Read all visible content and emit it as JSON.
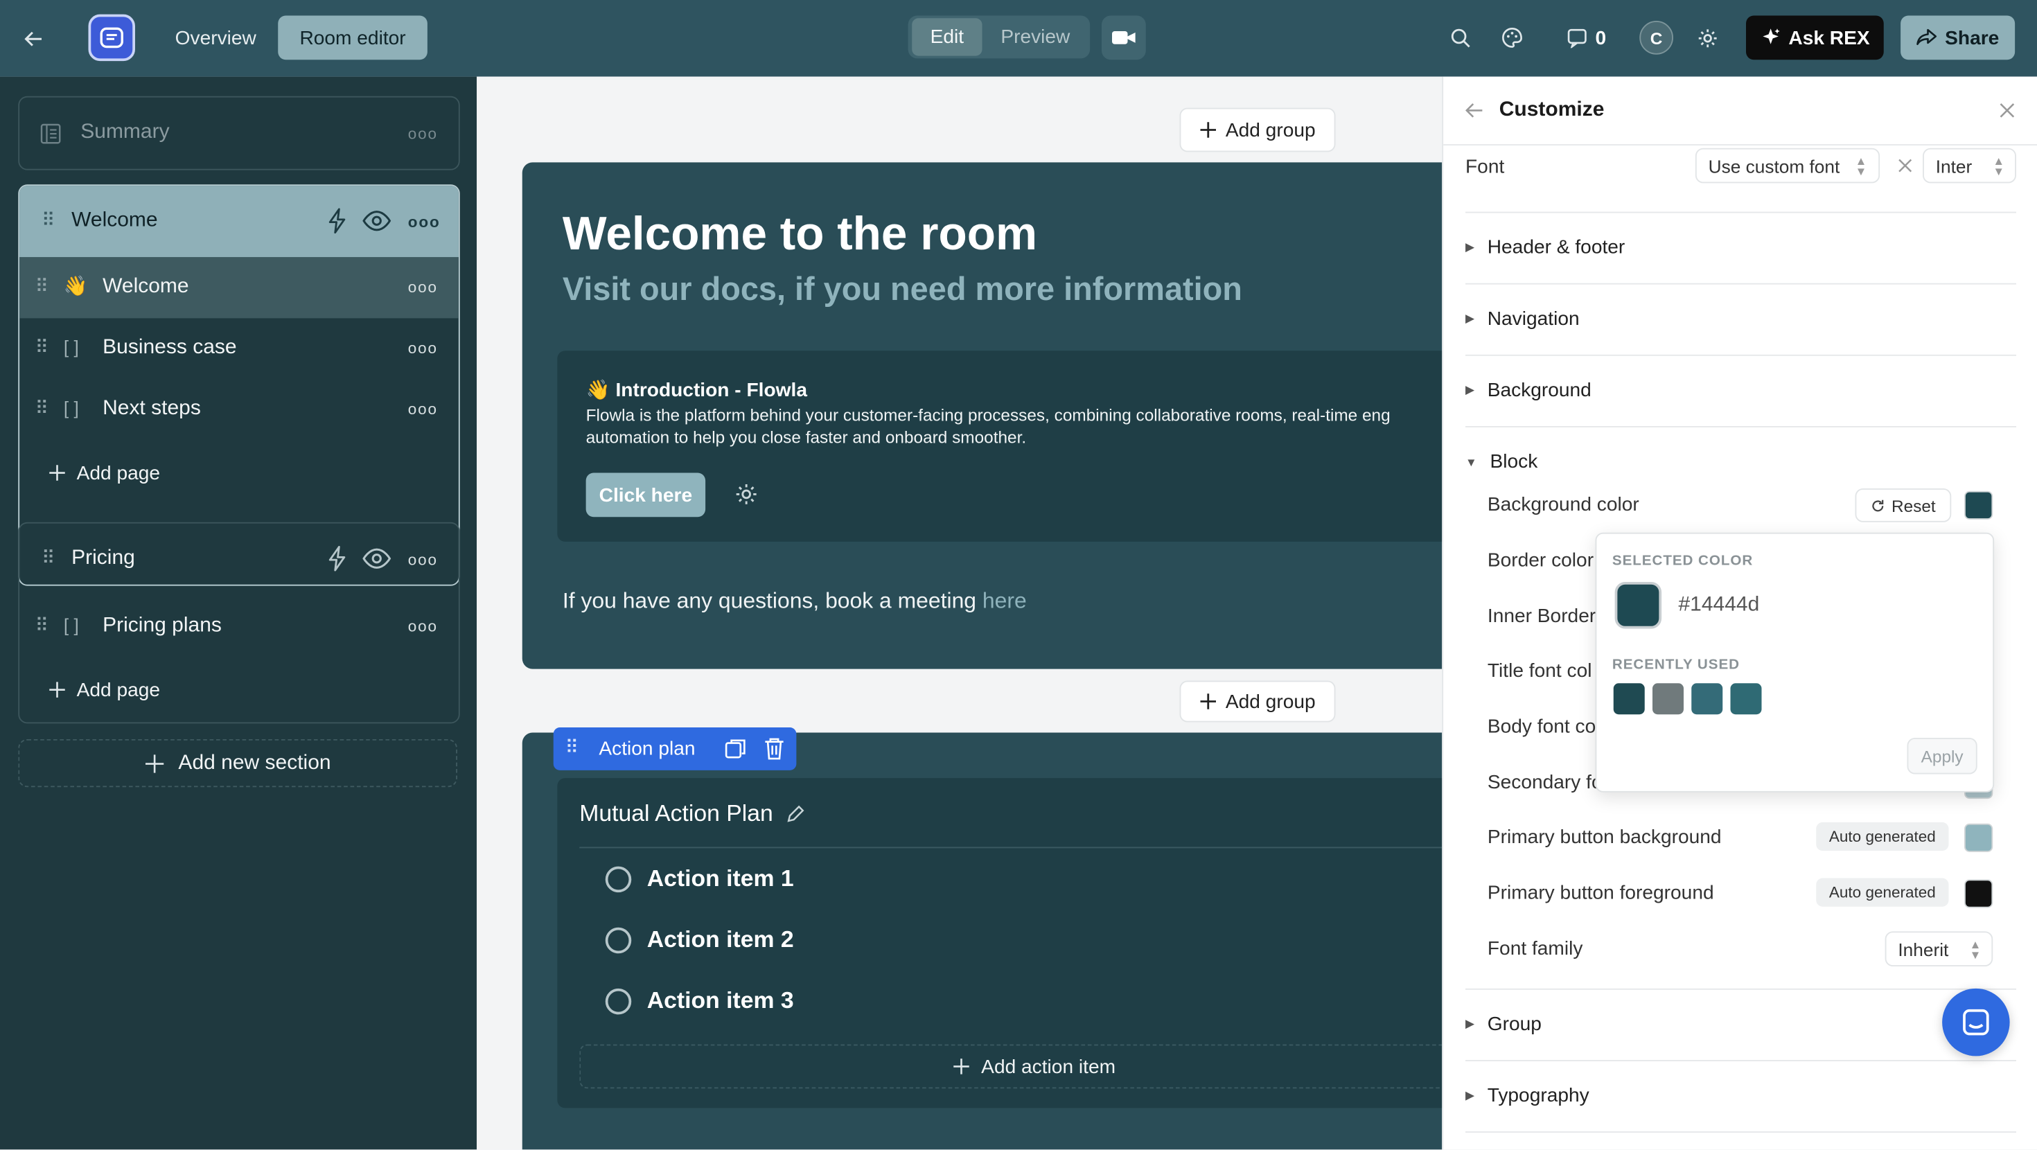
{
  "topbar": {
    "overview_tab": "Overview",
    "room_editor_tab": "Room editor",
    "edit_toggle": "Edit",
    "preview_toggle": "Preview",
    "comment_count": "0",
    "avatar_initial": "C",
    "ask_rex_label": "Ask REX",
    "share_label": "Share"
  },
  "sidebar": {
    "summary_label": "Summary",
    "sections": [
      {
        "title": "Welcome",
        "pages": [
          {
            "label": "Welcome",
            "icon": "waving-hand"
          },
          {
            "label": "Business case",
            "icon": "page-bracket"
          },
          {
            "label": "Next steps",
            "icon": "page-bracket"
          }
        ],
        "add_page": "Add page"
      },
      {
        "title": "Pricing",
        "pages": [
          {
            "label": "Pricing plans",
            "icon": "page-bracket"
          }
        ],
        "add_page": "Add page"
      }
    ],
    "add_section": "Add new section"
  },
  "canvas": {
    "add_group_label": "Add group",
    "welcome_block": {
      "title": "Welcome to the room",
      "subtitle": "Visit our docs, if you need more information",
      "intro_title": "👋 Introduction - Flowla",
      "intro_body_line1": "Flowla is the platform behind your customer-facing processes, combining collaborative rooms, real-time eng",
      "intro_body_line2": "automation to help you close faster and onboard smoother.",
      "cta_label": "Click here",
      "question_text": "If you have any questions, book a meeting ",
      "question_link": "here"
    },
    "action_plan": {
      "tab_label": "Action plan",
      "title": "Mutual Action Plan",
      "items": [
        "Action item 1",
        "Action item 2",
        "Action item 3"
      ],
      "add_item": "Add action item"
    }
  },
  "customize": {
    "title": "Customize",
    "font_label": "Font",
    "font_mode": "Use custom font",
    "font_name": "Inter",
    "sections": {
      "header_footer": "Header & footer",
      "navigation": "Navigation",
      "background": "Background",
      "block": "Block",
      "group": "Group",
      "typography": "Typography"
    },
    "block": {
      "background_color": "Background color",
      "reset": "Reset",
      "border_color": "Border color",
      "inner_border": "Inner Border",
      "title_font_color": "Title font col",
      "body_font_color": "Body font co",
      "secondary_font": "Secondary fo",
      "primary_button_background": "Primary button background",
      "primary_button_foreground": "Primary button foreground",
      "auto_generated": "Auto generated",
      "font_family": "Font family",
      "font_family_value": "Inherit"
    },
    "color_picker": {
      "selected_heading": "SELECTED COLOR",
      "selected_hex": "#14444d",
      "recent_heading": "RECENTLY USED",
      "recent_colors": [
        "#1f4a52",
        "#707a7c",
        "#346b78",
        "#2f6a74"
      ],
      "apply": "Apply"
    }
  },
  "colors": {
    "topbar": "#2f5460",
    "sidebar": "#1f393f",
    "block_bg": "#2a4d57",
    "accent_blue": "#2f6ae0",
    "selected_swatch": "#1e4952",
    "primary_btn_bg": "#8fb4bd",
    "primary_btn_fg": "#111111"
  }
}
